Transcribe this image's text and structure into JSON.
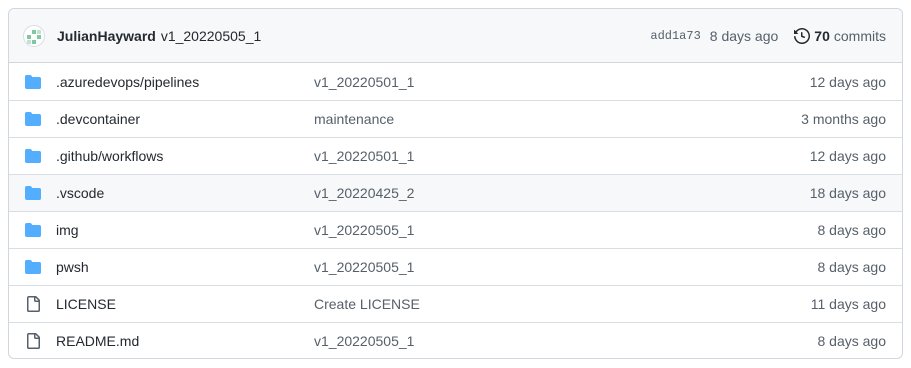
{
  "latest_commit": {
    "author": "JulianHayward",
    "message": "v1_20220505_1",
    "sha": "add1a73",
    "age": "8 days ago",
    "commit_count": "70",
    "commits_label": "commits"
  },
  "icons": {
    "folder": "folder-icon",
    "file": "file-icon",
    "history": "history-icon",
    "avatar": "avatar"
  },
  "colors": {
    "folder": "#54aeff",
    "file": "#57606a",
    "border": "#d0d7de",
    "header_bg": "#f6f8fa"
  },
  "rows": [
    {
      "type": "folder",
      "name": ".azuredevops/pipelines",
      "message": "v1_20220501_1",
      "age": "12 days ago"
    },
    {
      "type": "folder",
      "name": ".devcontainer",
      "message": "maintenance",
      "age": "3 months ago"
    },
    {
      "type": "folder",
      "name": ".github/workflows",
      "message": "v1_20220501_1",
      "age": "12 days ago"
    },
    {
      "type": "folder",
      "name": ".vscode",
      "message": "v1_20220425_2",
      "age": "18 days ago"
    },
    {
      "type": "folder",
      "name": "img",
      "message": "v1_20220505_1",
      "age": "8 days ago"
    },
    {
      "type": "folder",
      "name": "pwsh",
      "message": "v1_20220505_1",
      "age": "8 days ago"
    },
    {
      "type": "file",
      "name": "LICENSE",
      "message": "Create LICENSE",
      "age": "11 days ago"
    },
    {
      "type": "file",
      "name": "README.md",
      "message": "v1_20220505_1",
      "age": "8 days ago"
    }
  ]
}
